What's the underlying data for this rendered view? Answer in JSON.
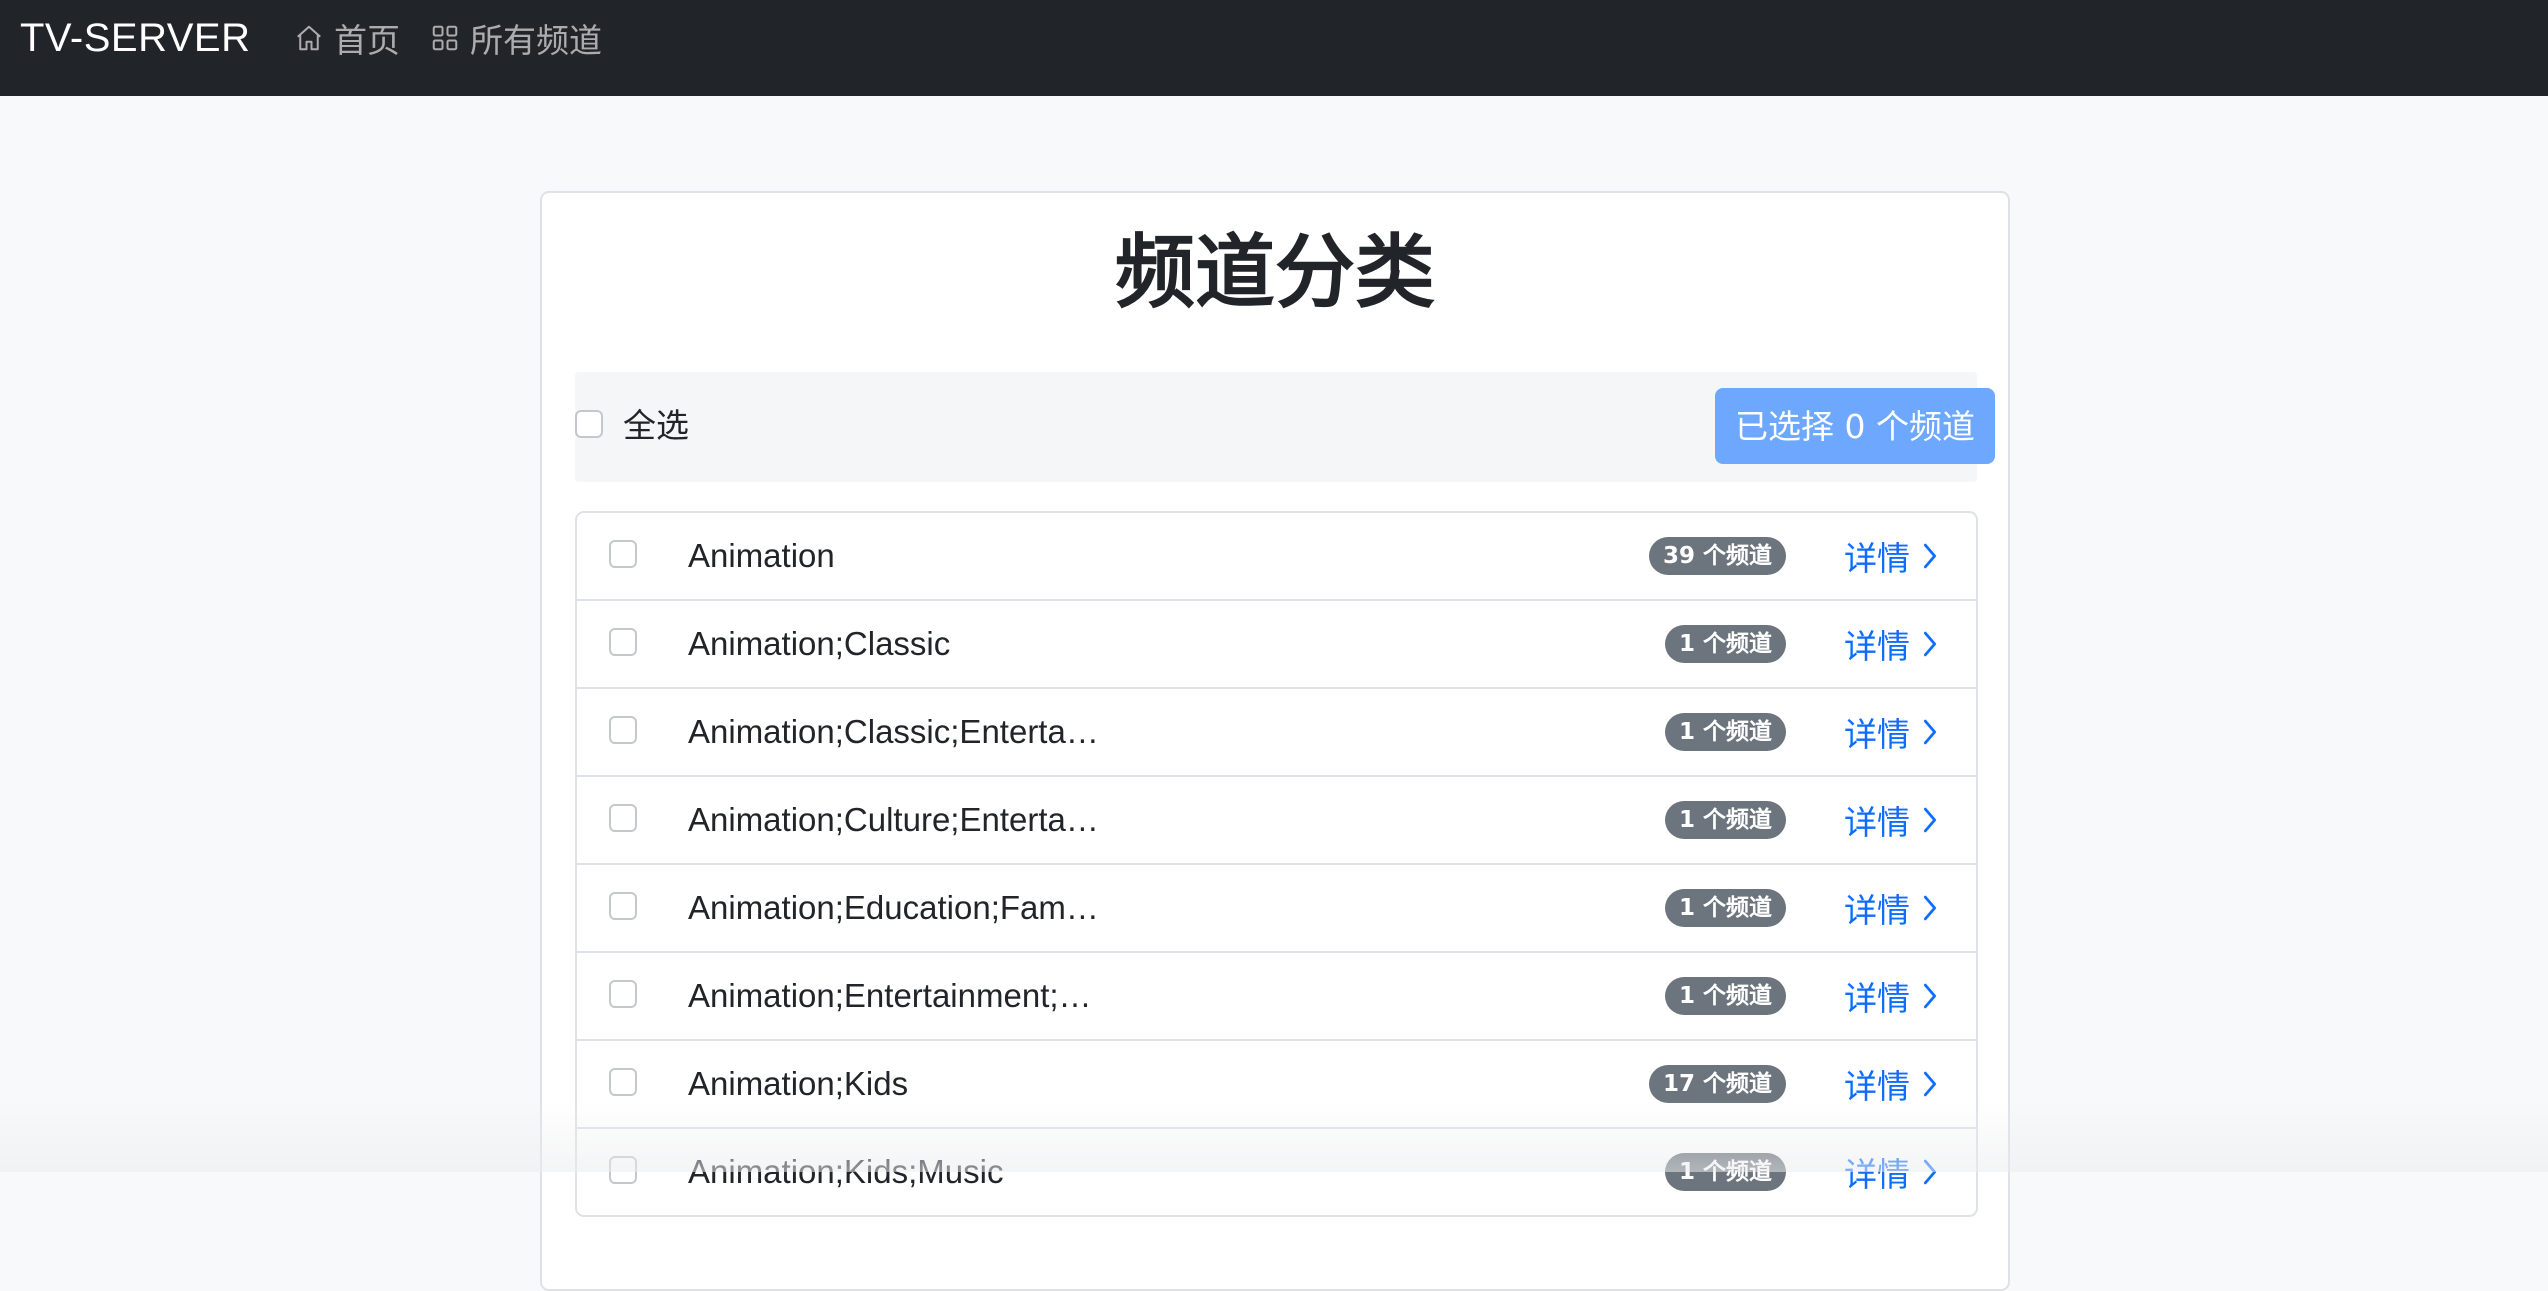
{
  "navbar": {
    "brand": "TV-SERVER",
    "links": [
      {
        "label": "首页",
        "icon": "house-icon"
      },
      {
        "label": "所有频道",
        "icon": "grid-icon"
      }
    ]
  },
  "page": {
    "title": "频道分类",
    "select_all_label": "全选",
    "selected_button_label": "已选择 0 个频道"
  },
  "categories": [
    {
      "name": "Animation",
      "count_label": "39 个频道",
      "detail_label": "详情"
    },
    {
      "name": "Animation;Classic",
      "count_label": "1 个频道",
      "detail_label": "详情"
    },
    {
      "name": "Animation;Classic;Enterta…",
      "count_label": "1 个频道",
      "detail_label": "详情"
    },
    {
      "name": "Animation;Culture;Enterta…",
      "count_label": "1 个频道",
      "detail_label": "详情"
    },
    {
      "name": "Animation;Education;Fam…",
      "count_label": "1 个频道",
      "detail_label": "详情"
    },
    {
      "name": "Animation;Entertainment;…",
      "count_label": "1 个频道",
      "detail_label": "详情"
    },
    {
      "name": "Animation;Kids",
      "count_label": "17 个频道",
      "detail_label": "详情"
    },
    {
      "name": "Animation;Kids;Music",
      "count_label": "1 个频道",
      "detail_label": "详情"
    }
  ],
  "colors": {
    "navbar_bg": "#212529",
    "primary": "#0d6efd",
    "button_light": "#6ea8fe",
    "badge_bg": "#6c757d"
  }
}
